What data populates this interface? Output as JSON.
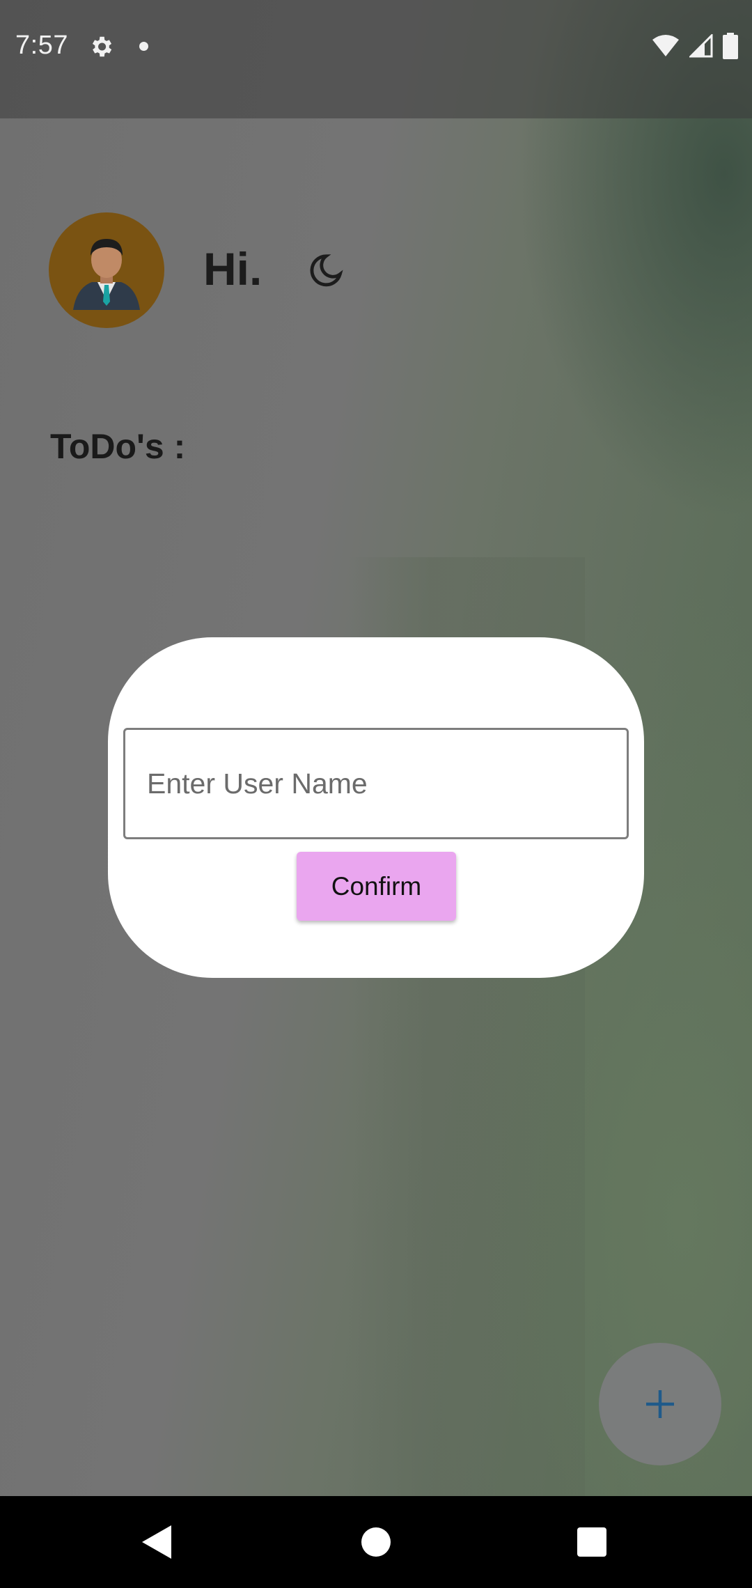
{
  "status_bar": {
    "time": "7:57"
  },
  "header": {
    "greeting": "Hi."
  },
  "main": {
    "section_title": "ToDo's :"
  },
  "dialog": {
    "input_placeholder": "Enter User Name",
    "input_value": "",
    "confirm_label": "Confirm"
  },
  "fab": {
    "icon": "plus-icon"
  },
  "colors": {
    "confirm_button": "#eaa6ef",
    "avatar_bg": "#7a5312",
    "fab_icon": "#1f5a8a"
  }
}
